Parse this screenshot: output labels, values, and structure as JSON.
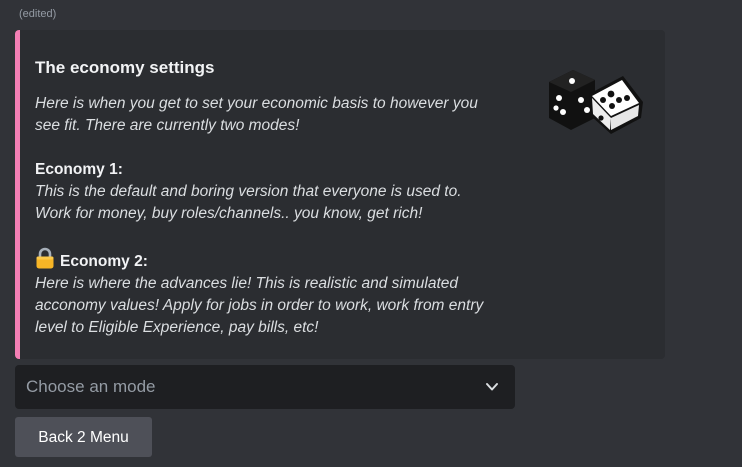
{
  "message": {
    "edited_label": "(edited)"
  },
  "embed": {
    "accent_color": "#f47fb5",
    "title": "The economy settings",
    "intro_line1": "Here is when you get to set your economic basis to however you",
    "intro_line2": "see fit. There are currently two modes!",
    "mode1": {
      "heading": "Economy 1:",
      "line1": "This is the default and boring version that everyone is used to.",
      "line2": "Work for money, buy roles/channels.. you know, get rich!"
    },
    "mode2": {
      "icon": "lock-icon",
      "heading": "Economy 2:",
      "line1": "Here is where the advances lie! This is realistic and simulated",
      "line2": "acconomy values! Apply for jobs in order to work, work from entry",
      "line3": "level to Eligible Experience, pay bills, etc!"
    },
    "thumbnail_icon": "dice-icon"
  },
  "select_menu": {
    "placeholder": "Choose an mode",
    "icon": "chevron-down-icon"
  },
  "back_button": {
    "label": "Back 2 Menu"
  }
}
